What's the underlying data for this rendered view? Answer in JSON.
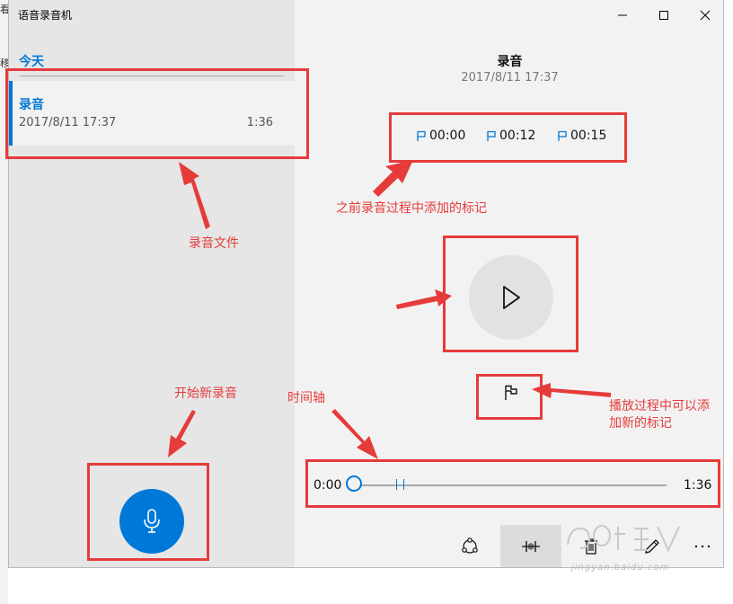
{
  "desktop": {
    "fragments": [
      "看",
      "移"
    ]
  },
  "window": {
    "title": "语音录音机"
  },
  "list": {
    "group": "今天",
    "item": {
      "name": "录音",
      "date": "2017/8/11 17:37",
      "duration": "1:36"
    }
  },
  "detail": {
    "title": "录音",
    "date": "2017/8/11 17:37",
    "markers": [
      "00:00",
      "00:12",
      "00:15"
    ]
  },
  "timeline": {
    "start": "0:00",
    "end": "1:36",
    "progress": 0.0
  },
  "annotations": {
    "markers_note": "之前录音过程中添加的标记",
    "file_note": "录音文件",
    "new_recording_note": "开始新录音",
    "timeline_note": "时间轴",
    "add_marker_note_line1": "播放过程中可以添",
    "add_marker_note_line2": "加新的标记"
  },
  "watermark": {
    "text": "jingyan.baidu.com"
  },
  "colors": {
    "accent": "#0078d7",
    "annotation": "#e63b3b",
    "sidebar": "#e6e6e6",
    "content": "#f2f2f2"
  },
  "icons": {
    "minimize": "minimize-icon",
    "maximize": "maximize-icon",
    "close": "close-icon",
    "marker": "flag-icon",
    "play": "play-icon",
    "add_marker": "flag-icon",
    "mic": "microphone-icon",
    "share": "share-icon",
    "trim": "trim-icon",
    "delete": "trash-icon",
    "rename": "pencil-icon",
    "more": "more-icon"
  }
}
